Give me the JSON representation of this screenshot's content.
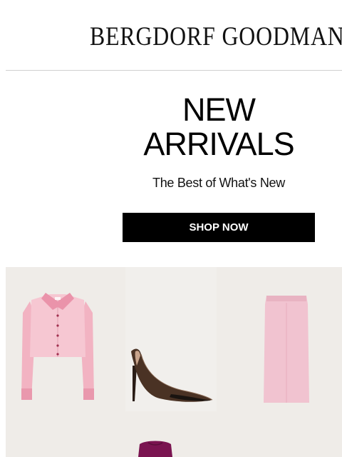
{
  "header": {
    "brand": "BERGDORF GOODMAN"
  },
  "hero": {
    "title_line1": "NEW",
    "title_line2": "ARRIVALS",
    "subtitle": "The Best of What's New",
    "cta_label": "SHOP NOW"
  },
  "colors": {
    "background": "#ffffff",
    "cta_background": "#000000",
    "cta_text": "#ffffff",
    "panel_background": "#efece8",
    "blouse": "#f2b8c6",
    "skirt": "#f1c3d0",
    "pump": "#3a2a20",
    "knit": "#7a1450"
  },
  "products": [
    {
      "icon": "pink-cropped-blouse"
    },
    {
      "icon": "dark-leather-pump"
    },
    {
      "icon": "pink-pencil-skirt"
    },
    {
      "icon": "magenta-knit-top"
    }
  ]
}
